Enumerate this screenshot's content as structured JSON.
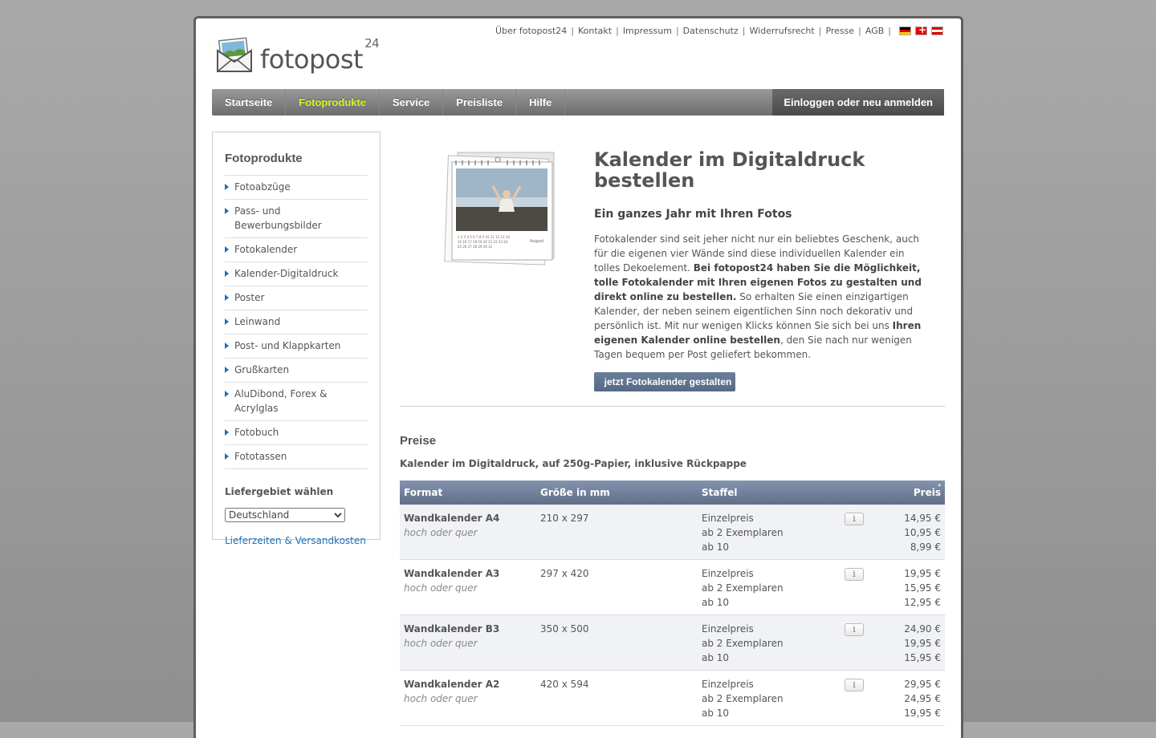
{
  "top_links": [
    "Über fotopost24",
    "Kontakt",
    "Impressum",
    "Datenschutz",
    "Widerrufsrecht",
    "Presse",
    "AGB"
  ],
  "logo": {
    "text": "fotopost",
    "sup": "24"
  },
  "nav": {
    "items": [
      "Startseite",
      "Fotoprodukte",
      "Service",
      "Preisliste",
      "Hilfe"
    ],
    "active": "Fotoprodukte",
    "login": "Einloggen oder neu anmelden"
  },
  "sidebar": {
    "title": "Fotoprodukte",
    "items": [
      "Fotoabzüge",
      "Pass- und Bewerbungsbilder",
      "Fotokalender",
      "Kalender-Digitaldruck",
      "Poster",
      "Leinwand",
      "Post- und Klappkarten",
      "Grußkarten",
      "AluDibond, Forex & Acrylglas",
      "Fotobuch",
      "Fototassen"
    ],
    "delivery_label": "Liefergebiet wählen",
    "delivery_value": "Deutschland",
    "shipping_link": "Lieferzeiten & Versandkosten"
  },
  "hero": {
    "title": "Kalender im Digitaldruck bestellen",
    "subtitle": "Ein ganzes Jahr mit Ihren Fotos",
    "p1": "Fotokalender sind seit jeher nicht nur ein beliebtes Geschenk, auch für die eigenen vier Wände sind diese individuellen Kalender ein tolles Dekoelement. ",
    "b1": "Bei fotopost24 haben Sie die Möglichkeit, tolle Fotokalender mit Ihren eigenen Fotos zu gestalten und direkt online zu bestellen.",
    "p2": " So erhalten Sie einen einzigartigen Kalender, der neben seinem eigentlichen Sinn noch dekorativ und persönlich ist. Mit nur wenigen Klicks können Sie sich bei uns ",
    "b2": "Ihren eigenen Kalender online bestellen",
    "p3": ", den Sie nach nur wenigen Tagen bequem per Post geliefert bekommen.",
    "cta": "jetzt Fotokalender gestalten",
    "calendar_month": "August"
  },
  "prices": {
    "heading": "Preise",
    "subheading": "Kalender im Digitaldruck, auf 250g-Papier, inklusive Rückpappe",
    "columns": {
      "format": "Format",
      "size": "Größe in mm",
      "tier": "Staffel",
      "price": "Preis",
      "price_note": "*"
    },
    "info_icon": "i",
    "rows": [
      {
        "name": "Wandkalender A4",
        "note": "hoch oder quer",
        "size": "210 x 297",
        "tiers": [
          "Einzelpreis",
          "ab 2 Exemplaren",
          "ab 10"
        ],
        "prices": [
          "14,95 €",
          "10,95 €",
          "8,99 €"
        ]
      },
      {
        "name": "Wandkalender A3",
        "note": "hoch oder quer",
        "size": "297 x 420",
        "tiers": [
          "Einzelpreis",
          "ab 2 Exemplaren",
          "ab 10"
        ],
        "prices": [
          "19,95 €",
          "15,95 €",
          "12,95 €"
        ]
      },
      {
        "name": "Wandkalender B3",
        "note": "hoch oder quer",
        "size": "350 x 500",
        "tiers": [
          "Einzelpreis",
          "ab 2 Exemplaren",
          "ab 10"
        ],
        "prices": [
          "24,90 €",
          "19,95 €",
          "15,95 €"
        ]
      },
      {
        "name": "Wandkalender A2",
        "note": "hoch oder quer",
        "size": "420 x 594",
        "tiers": [
          "Einzelpreis",
          "ab 2 Exemplaren",
          "ab 10"
        ],
        "prices": [
          "29,95 €",
          "24,95 €",
          "19,95 €"
        ]
      }
    ]
  }
}
